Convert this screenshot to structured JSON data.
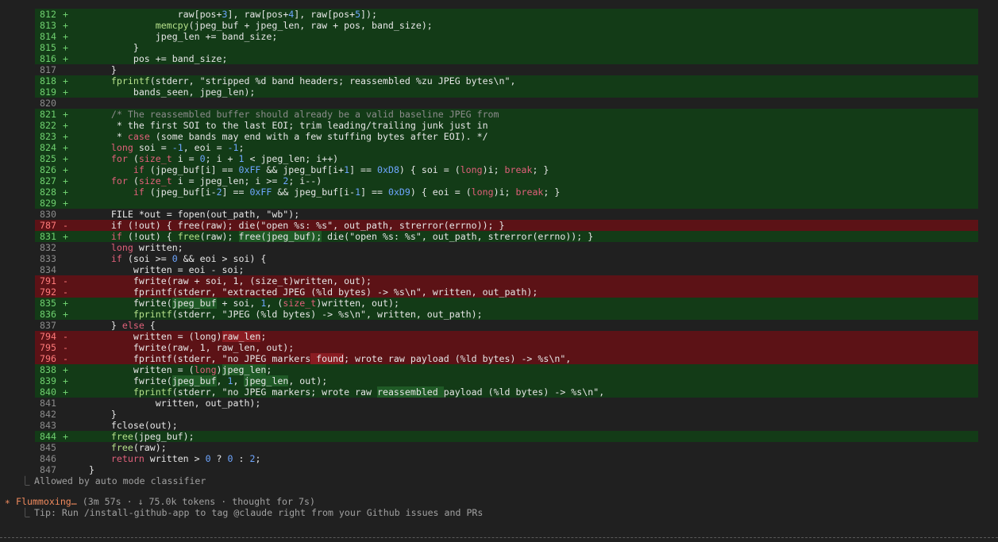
{
  "diff": {
    "lines": [
      {
        "n": "812",
        "s": "+",
        "t": "add",
        "code": [
          {
            "t": "                raw[pos+"
          },
          {
            "t": "3",
            "c": "num"
          },
          {
            "t": "], raw[pos+"
          },
          {
            "t": "4",
            "c": "num"
          },
          {
            "t": "], raw[pos+"
          },
          {
            "t": "5",
            "c": "num"
          },
          {
            "t": "]);"
          }
        ]
      },
      {
        "n": "813",
        "s": "+",
        "t": "add",
        "code": [
          {
            "t": "            "
          },
          {
            "t": "memcpy",
            "c": "fn"
          },
          {
            "t": "(jpeg_buf + jpeg_len, raw + pos, band_size);"
          }
        ]
      },
      {
        "n": "814",
        "s": "+",
        "t": "add",
        "code": [
          {
            "t": "            jpeg_len += band_size;"
          }
        ]
      },
      {
        "n": "815",
        "s": "+",
        "t": "add",
        "code": [
          {
            "t": "        }"
          }
        ]
      },
      {
        "n": "816",
        "s": "+",
        "t": "add",
        "code": [
          {
            "t": "        pos += band_size;"
          }
        ]
      },
      {
        "n": "817",
        "s": "",
        "t": "ctx",
        "code": [
          {
            "t": "    }"
          }
        ]
      },
      {
        "n": "818",
        "s": "+",
        "t": "add",
        "code": [
          {
            "t": "    "
          },
          {
            "t": "fprintf",
            "c": "fn"
          },
          {
            "t": "(stderr, \"stripped %d band headers; reassembled %zu JPEG bytes\\n\","
          }
        ]
      },
      {
        "n": "819",
        "s": "+",
        "t": "add",
        "code": [
          {
            "t": "        bands_seen, jpeg_len);"
          }
        ]
      },
      {
        "n": "820",
        "s": "",
        "t": "ctx",
        "code": [
          {
            "t": ""
          }
        ]
      },
      {
        "n": "821",
        "s": "+",
        "t": "add",
        "code": [
          {
            "t": "    /* The reassembled buffer should already be a valid baseline JPEG from",
            "c": "cm"
          }
        ]
      },
      {
        "n": "822",
        "s": "+",
        "t": "add",
        "code": [
          {
            "t": "     * the first SOI to the last EOI; trim leading/trailing junk just in"
          }
        ]
      },
      {
        "n": "823",
        "s": "+",
        "t": "add",
        "code": [
          {
            "t": "     * "
          },
          {
            "t": "case",
            "c": "kw"
          },
          {
            "t": " (some bands may end with a few stuffing bytes after EOI). */"
          }
        ]
      },
      {
        "n": "824",
        "s": "+",
        "t": "add",
        "code": [
          {
            "t": "    "
          },
          {
            "t": "long",
            "c": "kw"
          },
          {
            "t": " soi = "
          },
          {
            "t": "-1",
            "c": "num"
          },
          {
            "t": ", eoi = "
          },
          {
            "t": "-1",
            "c": "num"
          },
          {
            "t": ";"
          }
        ]
      },
      {
        "n": "825",
        "s": "+",
        "t": "add",
        "code": [
          {
            "t": "    "
          },
          {
            "t": "for",
            "c": "kw"
          },
          {
            "t": " ("
          },
          {
            "t": "size_t",
            "c": "kw"
          },
          {
            "t": " i = "
          },
          {
            "t": "0",
            "c": "num"
          },
          {
            "t": "; i + "
          },
          {
            "t": "1",
            "c": "num"
          },
          {
            "t": " < jpeg_len; i++)"
          }
        ]
      },
      {
        "n": "826",
        "s": "+",
        "t": "add",
        "code": [
          {
            "t": "        "
          },
          {
            "t": "if",
            "c": "kw"
          },
          {
            "t": " (jpeg_buf[i] == "
          },
          {
            "t": "0xFF",
            "c": "num"
          },
          {
            "t": " && jpeg_buf[i+"
          },
          {
            "t": "1",
            "c": "num"
          },
          {
            "t": "] == "
          },
          {
            "t": "0xD8",
            "c": "num"
          },
          {
            "t": ") { soi = ("
          },
          {
            "t": "long",
            "c": "kw"
          },
          {
            "t": ")i; "
          },
          {
            "t": "break",
            "c": "kw"
          },
          {
            "t": "; }"
          }
        ]
      },
      {
        "n": "827",
        "s": "+",
        "t": "add",
        "code": [
          {
            "t": "    "
          },
          {
            "t": "for",
            "c": "kw"
          },
          {
            "t": " ("
          },
          {
            "t": "size_t",
            "c": "kw"
          },
          {
            "t": " i = jpeg_len; i >= "
          },
          {
            "t": "2",
            "c": "num"
          },
          {
            "t": "; i--)"
          }
        ]
      },
      {
        "n": "828",
        "s": "+",
        "t": "add",
        "code": [
          {
            "t": "        "
          },
          {
            "t": "if",
            "c": "kw"
          },
          {
            "t": " (jpeg_buf[i-"
          },
          {
            "t": "2",
            "c": "num"
          },
          {
            "t": "] == "
          },
          {
            "t": "0xFF",
            "c": "num"
          },
          {
            "t": " && jpeg_buf[i-"
          },
          {
            "t": "1",
            "c": "num"
          },
          {
            "t": "] == "
          },
          {
            "t": "0xD9",
            "c": "num"
          },
          {
            "t": ") { eoi = ("
          },
          {
            "t": "long",
            "c": "kw"
          },
          {
            "t": ")i; "
          },
          {
            "t": "break",
            "c": "kw"
          },
          {
            "t": "; }"
          }
        ]
      },
      {
        "n": "829",
        "s": "+",
        "t": "add",
        "code": [
          {
            "t": ""
          }
        ]
      },
      {
        "n": "830",
        "s": "",
        "t": "ctx",
        "code": [
          {
            "t": "    FILE *out = fopen(out_path, \"wb\");"
          }
        ]
      },
      {
        "n": "787",
        "s": "-",
        "t": "del",
        "code": [
          {
            "t": "    if (!out) { free(raw); die(\"open %s: %s\", out_path, strerror(errno)); }"
          }
        ]
      },
      {
        "n": "831",
        "s": "+",
        "t": "add",
        "code": [
          {
            "t": "    "
          },
          {
            "t": "if",
            "c": "kw"
          },
          {
            "t": " (!out) { "
          },
          {
            "t": "free",
            "c": "fn"
          },
          {
            "t": "(raw); "
          },
          {
            "t": "free(jpeg_buf);",
            "c": "hladd"
          },
          {
            "t": " die(\"open %s: %s\", out_path, strerror(errno)); }"
          }
        ]
      },
      {
        "n": "832",
        "s": "",
        "t": "ctx",
        "code": [
          {
            "t": "    "
          },
          {
            "t": "long",
            "c": "kw"
          },
          {
            "t": " written;"
          }
        ]
      },
      {
        "n": "833",
        "s": "",
        "t": "ctx",
        "code": [
          {
            "t": "    "
          },
          {
            "t": "if",
            "c": "kw"
          },
          {
            "t": " (soi >= "
          },
          {
            "t": "0",
            "c": "num"
          },
          {
            "t": " && eoi > soi) {"
          }
        ]
      },
      {
        "n": "834",
        "s": "",
        "t": "ctx",
        "code": [
          {
            "t": "        written = eoi - soi;"
          }
        ]
      },
      {
        "n": "791",
        "s": "-",
        "t": "del",
        "code": [
          {
            "t": "        fwrite(raw + soi, 1, (size_t)written, out);"
          }
        ]
      },
      {
        "n": "792",
        "s": "-",
        "t": "del",
        "code": [
          {
            "t": "        fprintf(stderr, \"extracted JPEG (%ld bytes) -> %s\\n\", written, out_path);"
          }
        ]
      },
      {
        "n": "835",
        "s": "+",
        "t": "add",
        "code": [
          {
            "t": "        fwrite("
          },
          {
            "t": "jpeg_buf",
            "c": "hladd"
          },
          {
            "t": " + soi, "
          },
          {
            "t": "1",
            "c": "num"
          },
          {
            "t": ", ("
          },
          {
            "t": "size_t",
            "c": "kw"
          },
          {
            "t": ")written, out);"
          }
        ]
      },
      {
        "n": "836",
        "s": "+",
        "t": "add",
        "code": [
          {
            "t": "        "
          },
          {
            "t": "fprintf",
            "c": "fn"
          },
          {
            "t": "(stderr, \"JPEG (%ld bytes) -> %s\\n\", written, out_path);"
          }
        ]
      },
      {
        "n": "837",
        "s": "",
        "t": "ctx",
        "code": [
          {
            "t": "    } "
          },
          {
            "t": "else",
            "c": "kw"
          },
          {
            "t": " {"
          }
        ]
      },
      {
        "n": "794",
        "s": "-",
        "t": "del",
        "code": [
          {
            "t": "        written = (long)"
          },
          {
            "t": "raw_len",
            "c": "hldel"
          },
          {
            "t": ";"
          }
        ]
      },
      {
        "n": "795",
        "s": "-",
        "t": "del",
        "code": [
          {
            "t": "        fwrite(raw, 1, raw_len, out);"
          }
        ]
      },
      {
        "n": "796",
        "s": "-",
        "t": "del",
        "code": [
          {
            "t": "        fprintf(stderr, \"no JPEG markers"
          },
          {
            "t": " found",
            "c": "hldel"
          },
          {
            "t": "; wrote raw payload (%ld bytes) -> %s\\n\","
          }
        ]
      },
      {
        "n": "838",
        "s": "+",
        "t": "add",
        "code": [
          {
            "t": "        written = ("
          },
          {
            "t": "long",
            "c": "kw"
          },
          {
            "t": ")"
          },
          {
            "t": "jpeg_len",
            "c": "hladd"
          },
          {
            "t": ";"
          }
        ]
      },
      {
        "n": "839",
        "s": "+",
        "t": "add",
        "code": [
          {
            "t": "        fwrite("
          },
          {
            "t": "jpeg_buf",
            "c": "hladd"
          },
          {
            "t": ", "
          },
          {
            "t": "1",
            "c": "num"
          },
          {
            "t": ", "
          },
          {
            "t": "jpeg_len",
            "c": "hladd"
          },
          {
            "t": ", out);"
          }
        ]
      },
      {
        "n": "840",
        "s": "+",
        "t": "add",
        "code": [
          {
            "t": "        "
          },
          {
            "t": "fprintf",
            "c": "fn"
          },
          {
            "t": "(stderr, \"no JPEG markers; wrote raw "
          },
          {
            "t": "reassembled ",
            "c": "hladd"
          },
          {
            "t": "payload (%ld bytes) -> %s\\n\","
          }
        ]
      },
      {
        "n": "841",
        "s": "",
        "t": "ctx",
        "code": [
          {
            "t": "            written, out_path);"
          }
        ]
      },
      {
        "n": "842",
        "s": "",
        "t": "ctx",
        "code": [
          {
            "t": "    }"
          }
        ]
      },
      {
        "n": "843",
        "s": "",
        "t": "ctx",
        "code": [
          {
            "t": "    fclose(out);"
          }
        ]
      },
      {
        "n": "844",
        "s": "+",
        "t": "add",
        "code": [
          {
            "t": "    "
          },
          {
            "t": "free",
            "c": "fn"
          },
          {
            "t": "(jpeg_buf);"
          }
        ]
      },
      {
        "n": "845",
        "s": "",
        "t": "ctx",
        "code": [
          {
            "t": "    "
          },
          {
            "t": "free",
            "c": "fn"
          },
          {
            "t": "(raw);"
          }
        ]
      },
      {
        "n": "846",
        "s": "",
        "t": "ctx",
        "code": [
          {
            "t": "    "
          },
          {
            "t": "return",
            "c": "kw"
          },
          {
            "t": " written > "
          },
          {
            "t": "0",
            "c": "num"
          },
          {
            "t": " ? "
          },
          {
            "t": "0",
            "c": "num"
          },
          {
            "t": " : "
          },
          {
            "t": "2",
            "c": "num"
          },
          {
            "t": ";"
          }
        ]
      },
      {
        "n": "847",
        "s": "",
        "t": "ctx",
        "code": [
          {
            "t": "}"
          }
        ]
      }
    ]
  },
  "status": {
    "allowed_glyph": "⎿",
    "allowed_text": "Allowed by auto mode classifier",
    "spinner_glyph": "∗",
    "spinner_label": "Flummoxing…",
    "spinner_detail": "(3m 57s · ↓ 75.0k tokens · thought for 7s)",
    "tip_glyph": "⎿",
    "tip_text": "Tip: Run /install-github-app to tag @claude right from your Github issues and PRs"
  },
  "colors": {
    "add_bg": "#133b17",
    "del_bg": "#5c1216",
    "accent": "#f08a5d"
  }
}
